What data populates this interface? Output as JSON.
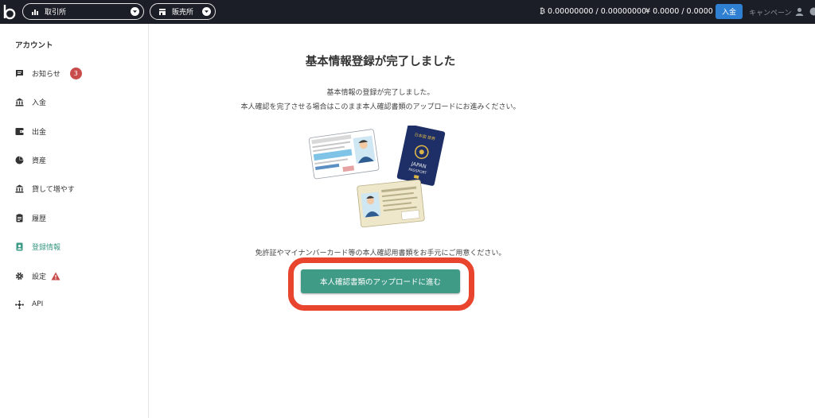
{
  "header": {
    "logo": "b-logo-icon",
    "exchange_label": "取引所",
    "store_label": "販売所",
    "btc_balance": "₿ 0.00000000 / 0.00000000",
    "jpy_balance": "¥ 0.0000 / 0.0000",
    "deposit_label": "入金",
    "campaign_label": "キャンペーン"
  },
  "sidebar": {
    "heading": "アカウント",
    "items": [
      {
        "label": "お知らせ",
        "icon": "message-icon",
        "badge": "3"
      },
      {
        "label": "入金",
        "icon": "bank-icon"
      },
      {
        "label": "出金",
        "icon": "wallet-icon"
      },
      {
        "label": "資産",
        "icon": "pie-chart-icon"
      },
      {
        "label": "貸して増やす",
        "icon": "bank-icon"
      },
      {
        "label": "履歴",
        "icon": "clipboard-icon"
      },
      {
        "label": "登録情報",
        "icon": "id-badge-icon",
        "active": true
      },
      {
        "label": "設定",
        "icon": "gear-icon",
        "warning": true
      },
      {
        "label": "API",
        "icon": "network-icon"
      }
    ]
  },
  "main": {
    "title": "基本情報登録が完了しました",
    "line1": "基本情報の登録が完了しました。",
    "line2": "本人確認を完了させる場合はこのまま本人確認書類のアップロードにお進みください。",
    "line3": "免許証やマイナンバーカード等の本人確認用書類をお手元にご用意ください。",
    "cta_label": "本人確認書類のアップロードに進む",
    "passport_text": "JAPAN",
    "passport_sub": "PASSPORT",
    "passport_jp": "日本国 旅券"
  },
  "colors": {
    "topbar": "#1b1e26",
    "accent": "#3f9a86",
    "deposit": "#2f7fd3",
    "highlight": "#e8442e",
    "badge": "#c94c4c"
  }
}
